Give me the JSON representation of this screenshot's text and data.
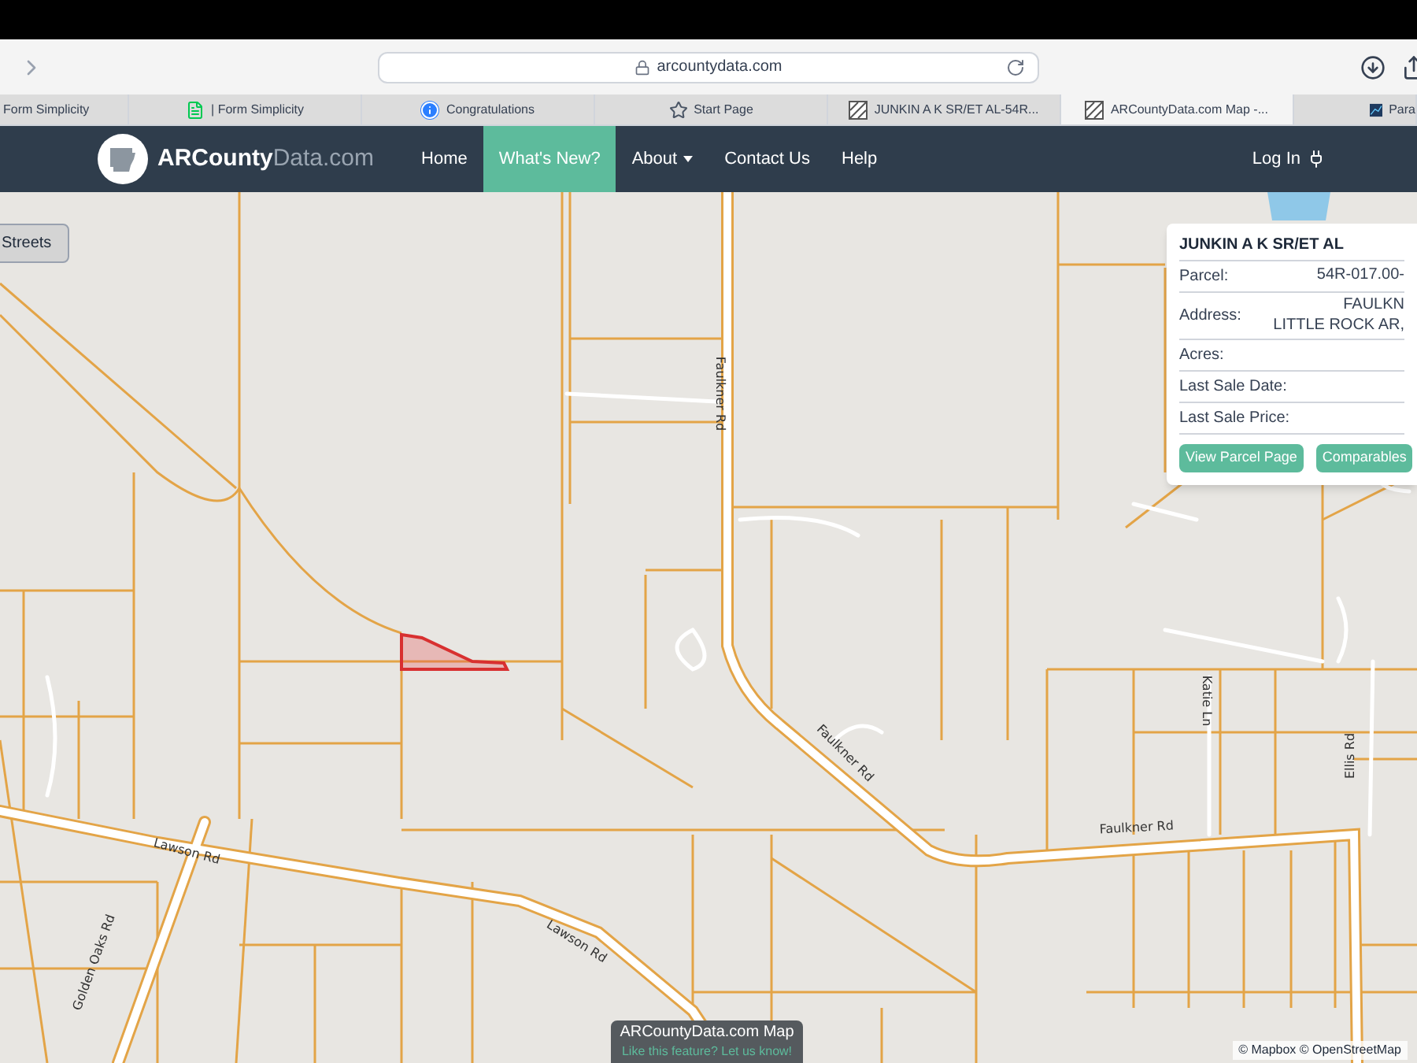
{
  "browser": {
    "url": "arcountydata.com"
  },
  "tabs": [
    {
      "title": "Form Simplicity",
      "kind": "none",
      "selected": false
    },
    {
      "title": "| Form Simplicity",
      "kind": "doc",
      "selected": false
    },
    {
      "title": "Congratulations",
      "kind": "info",
      "selected": false
    },
    {
      "title": "Start Page",
      "kind": "star",
      "selected": false
    },
    {
      "title": "JUNKIN A K SR/ET AL-54R...",
      "kind": "logo",
      "selected": false
    },
    {
      "title": "ARCountyData.com Map -...",
      "kind": "logo",
      "selected": true
    },
    {
      "title": "Para",
      "kind": "chart",
      "selected": false
    }
  ],
  "nav": {
    "brand_main": "ARCounty",
    "brand_accent": "Data.com",
    "items": [
      {
        "label": "Home",
        "selected": false
      },
      {
        "label": "What's New?",
        "selected": true
      },
      {
        "label": "About",
        "selected": false,
        "dropdown": true
      },
      {
        "label": "Contact Us",
        "selected": false
      },
      {
        "label": "Help",
        "selected": false
      }
    ],
    "login": "Log In"
  },
  "map": {
    "layer_button": "Streets",
    "road_labels": [
      "Faulkner Rd",
      "Faulkner Rd",
      "Faulkner Rd",
      "Lawson Rd",
      "Lawson Rd",
      "Golden Oaks Rd",
      "Katie Ln",
      "Ellis Rd"
    ],
    "popup": {
      "title": "JUNKIN A K SR/ET AL",
      "rows": [
        {
          "label": "Parcel:",
          "value": [
            "54R-017.00-"
          ]
        },
        {
          "label": "Address:",
          "value": [
            "FAULKN",
            "LITTLE ROCK AR,"
          ]
        },
        {
          "label": "Acres:",
          "value": []
        },
        {
          "label": "Last Sale Date:",
          "value": []
        },
        {
          "label": "Last Sale Price:",
          "value": []
        }
      ],
      "buttons": [
        "View Parcel Page",
        "Comparables"
      ]
    },
    "banner": {
      "title": "ARCountyData.com Map",
      "link": "Like this feature? Let us know!"
    },
    "attribution": "© Mapbox © OpenStreetMap"
  }
}
